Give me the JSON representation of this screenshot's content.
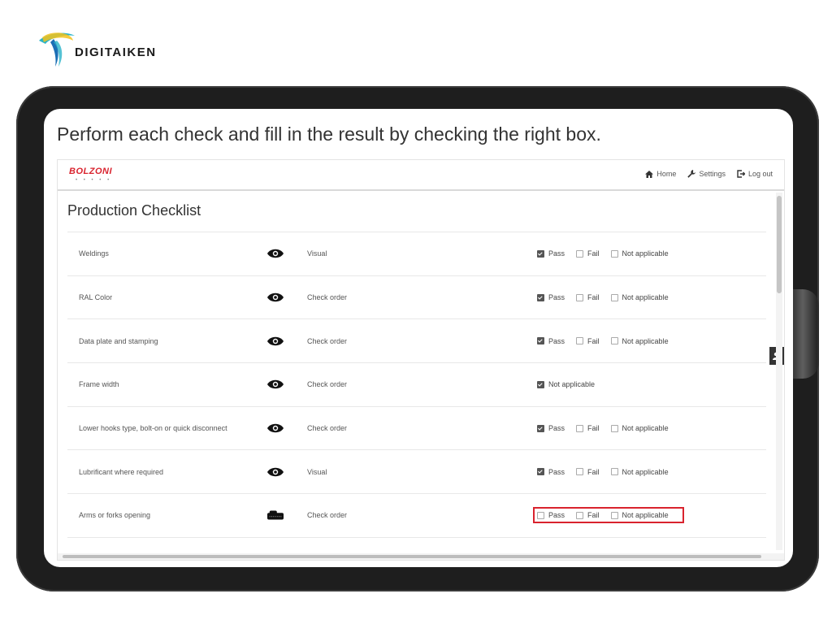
{
  "brand": {
    "name": "DIGITAIKEN"
  },
  "instruction": "Perform each check and fill in the result by checking the right box.",
  "app": {
    "logo": "BOLZONI",
    "nav": [
      {
        "label": "Home",
        "icon": "home-icon"
      },
      {
        "label": "Settings",
        "icon": "wrench-icon"
      },
      {
        "label": "Log out",
        "icon": "logout-icon"
      }
    ],
    "page_title": "Production Checklist"
  },
  "rows": [
    {
      "name": "Weldings",
      "icon": "eye-icon",
      "method": "Visual",
      "options": [
        {
          "label": "Pass",
          "checked": true
        },
        {
          "label": "Fail",
          "checked": false
        },
        {
          "label": "Not applicable",
          "checked": false
        }
      ]
    },
    {
      "name": "RAL Color",
      "icon": "eye-icon",
      "method": "Check order",
      "options": [
        {
          "label": "Pass",
          "checked": true
        },
        {
          "label": "Fail",
          "checked": false
        },
        {
          "label": "Not applicable",
          "checked": false
        }
      ]
    },
    {
      "name": "Data plate and stamping",
      "icon": "eye-icon",
      "method": "Check order",
      "options": [
        {
          "label": "Pass",
          "checked": true
        },
        {
          "label": "Fail",
          "checked": false
        },
        {
          "label": "Not applicable",
          "checked": false
        }
      ]
    },
    {
      "name": "Frame width",
      "icon": "eye-icon",
      "method": "Check order",
      "options": [
        {
          "label": "Not applicable",
          "checked": true
        }
      ]
    },
    {
      "name": "Lower hooks type, bolt-on or quick disconnect",
      "icon": "eye-icon",
      "method": "Check order",
      "options": [
        {
          "label": "Pass",
          "checked": true
        },
        {
          "label": "Fail",
          "checked": false
        },
        {
          "label": "Not applicable",
          "checked": false
        }
      ]
    },
    {
      "name": "Lubrificant where required",
      "icon": "eye-icon",
      "method": "Visual",
      "options": [
        {
          "label": "Pass",
          "checked": true
        },
        {
          "label": "Fail",
          "checked": false
        },
        {
          "label": "Not applicable",
          "checked": false
        }
      ]
    },
    {
      "name": "Arms or forks opening",
      "icon": "tape-measure-icon",
      "method": "Check order",
      "highlight": true,
      "options": [
        {
          "label": "Pass",
          "checked": false
        },
        {
          "label": "Fail",
          "checked": false
        },
        {
          "label": "Not applicable",
          "checked": false
        }
      ]
    }
  ],
  "colors": {
    "accent": "#d9232e",
    "checked": "#555555"
  }
}
